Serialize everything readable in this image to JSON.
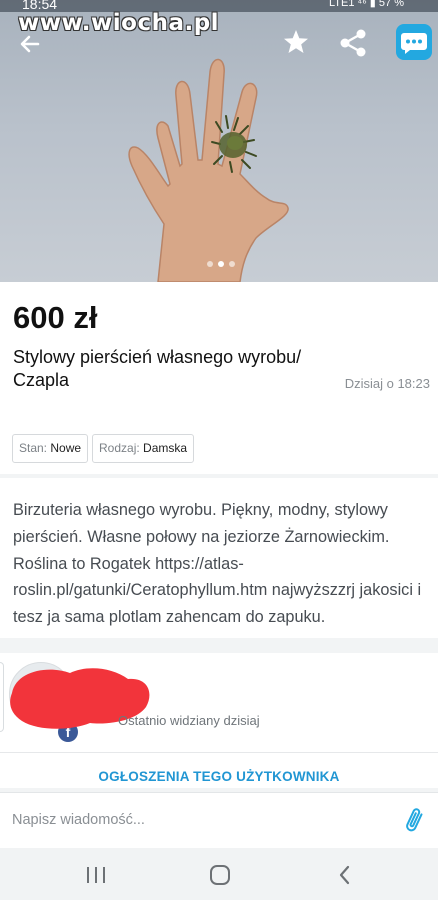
{
  "statusbar": {
    "time": "18:54",
    "right": "LTE1 ⁴⁶ ▮ 57 %"
  },
  "watermark": "www.wiocha.pl",
  "gallery": {
    "dots": 3,
    "active_index": 1
  },
  "listing": {
    "price": "600 zł",
    "title": "Stylowy pierścień własnego wyrobu/ Czapla",
    "posted": "Dzisiaj o 18:23",
    "params": [
      {
        "label": "Stan:",
        "value": "Nowe"
      },
      {
        "label": "Rodzaj:",
        "value": "Damska"
      }
    ],
    "description": "Birzuteria własnego wyrobu. Piękny, modny,  stylowy pierścień. Własne połowy na jeziorze Żarnowieckim. Roślina to Rogatek https://atlas-roslin.pl/gatunki/Ceratophyllum.htm najwyższzrj jakosici i tesz ja sama plotlam zahencam do zapuku."
  },
  "seller": {
    "last_seen": "Ostatnio widziany dzisiaj",
    "ads_link": "OGŁOSZENIA TEGO UŻYTKOWNIKA"
  },
  "message": {
    "placeholder": "Napisz wiadomość..."
  },
  "colors": {
    "accent": "#23a8e0",
    "link": "#2196d3",
    "redaction": "#f2343b",
    "facebook": "#3b5998"
  },
  "icons": [
    "back-arrow-icon",
    "star-icon",
    "share-icon",
    "chat-icon",
    "facebook-icon",
    "paperclip-icon",
    "recent-apps-icon",
    "home-icon",
    "nav-back-icon"
  ]
}
